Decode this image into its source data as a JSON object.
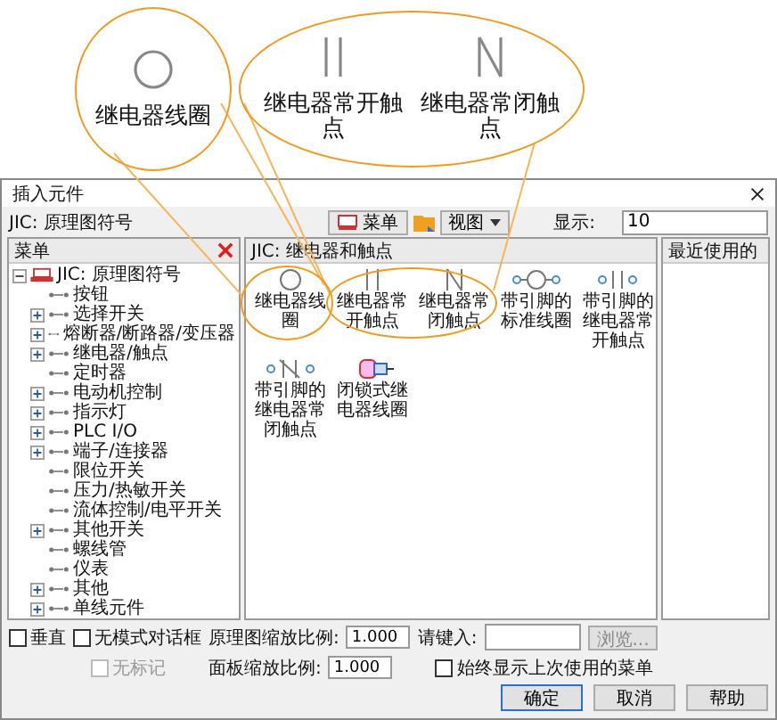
{
  "callouts": [
    {
      "items": [
        {
          "label": "继电器线圈",
          "kind": "coil"
        }
      ]
    },
    {
      "items": [
        {
          "label": "继电器常开触点",
          "kind": "no_contact"
        },
        {
          "label": "继电器常闭触点",
          "kind": "nc_contact"
        }
      ]
    }
  ],
  "window": {
    "title": "插入元件"
  },
  "library_label": "JIC: 原理图符号",
  "toolbar": {
    "menu_button": "菜单",
    "view_button": "视图",
    "display_label": "显示:",
    "display_value": "10"
  },
  "menu_panel": {
    "title": "菜单",
    "tree": {
      "label": "JIC: 原理图符号",
      "expanded": true,
      "children": [
        {
          "label": "按钮",
          "expandable": false
        },
        {
          "label": "选择开关",
          "expandable": true
        },
        {
          "label": "熔断器/断路器/变压器",
          "expandable": true
        },
        {
          "label": "继电器/触点",
          "expandable": true
        },
        {
          "label": "定时器",
          "expandable": false
        },
        {
          "label": "电动机控制",
          "expandable": true
        },
        {
          "label": "指示灯",
          "expandable": true
        },
        {
          "label": "PLC I/O",
          "expandable": true
        },
        {
          "label": "端子/连接器",
          "expandable": true
        },
        {
          "label": "限位开关",
          "expandable": false
        },
        {
          "label": "压力/热敏开关",
          "expandable": false
        },
        {
          "label": "流体控制/电平开关",
          "expandable": false
        },
        {
          "label": "其他开关",
          "expandable": true
        },
        {
          "label": "螺线管",
          "expandable": false
        },
        {
          "label": "仪表",
          "expandable": false
        },
        {
          "label": "其他",
          "expandable": true
        },
        {
          "label": "单线元件",
          "expandable": true
        }
      ]
    }
  },
  "symbols_panel": {
    "title": "JIC: 继电器和触点",
    "items": [
      {
        "label": "继电器线圈",
        "kind": "coil"
      },
      {
        "label": "继电器常开触点",
        "kind": "no_contact"
      },
      {
        "label": "继电器常闭触点",
        "kind": "nc_contact"
      },
      {
        "label": "带引脚的标准线圈",
        "kind": "pin_coil"
      },
      {
        "label": "带引脚的继电器常开触点",
        "kind": "pin_no"
      },
      {
        "label": "带引脚的继电器常闭触点",
        "kind": "pin_nc"
      },
      {
        "label": "闭锁式继电器线圈",
        "kind": "latch"
      }
    ]
  },
  "recent_panel": {
    "title": "最近使用的"
  },
  "vertical": {
    "label": "垂直",
    "checked": false
  },
  "modeless": {
    "label": "无模式对话框",
    "checked": false
  },
  "no_tag": {
    "label": "无标记",
    "checked": false,
    "disabled": true
  },
  "schematic_scale": {
    "label": "原理图缩放比例:",
    "value": "1.000"
  },
  "prompt": {
    "label": "请键入:"
  },
  "browse": {
    "label": "浏览...",
    "disabled": true
  },
  "panel_scale": {
    "label": "面板缩放比例:",
    "value": "1.000"
  },
  "always_show": {
    "label": "始终显示上次使用的菜单",
    "checked": false
  },
  "buttons": [
    {
      "label": "确定",
      "default": true
    },
    {
      "label": "取消",
      "default": false
    },
    {
      "label": "帮助",
      "default": false
    }
  ]
}
